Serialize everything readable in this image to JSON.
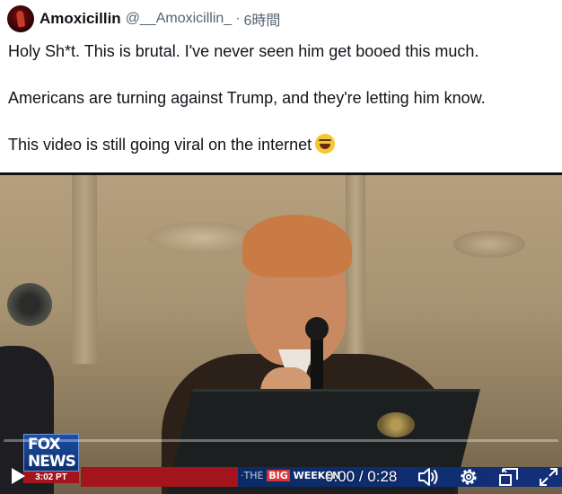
{
  "post": {
    "author_name": "Amoxicillin",
    "handle": "@__Amoxicillin_",
    "separator": "·",
    "time": "6時間",
    "lines": [
      "Holy Sh*t. This is brutal. I've never seen him get booed this much.",
      "Americans are turning against Trump, and they're letting him know.",
      "This video is still going viral on the internet"
    ],
    "emoji": "grinning-squinting-face"
  },
  "video": {
    "current_time": "0:00",
    "time_separator": "/",
    "duration": "0:28",
    "progress_fraction": 0.0,
    "overlay": {
      "logo_line1": "FOX",
      "logo_line2": "NEWS",
      "timestamp": "3:02 PT",
      "ticker_lead": "·THE",
      "ticker_big": "BIG",
      "ticker_rest": "WEEKEN"
    },
    "icons": {
      "play": "play-icon",
      "volume": "volume-icon",
      "settings": "gear-icon",
      "miniplayer": "miniplayer-icon",
      "fullscreen": "fullscreen-icon"
    }
  }
}
